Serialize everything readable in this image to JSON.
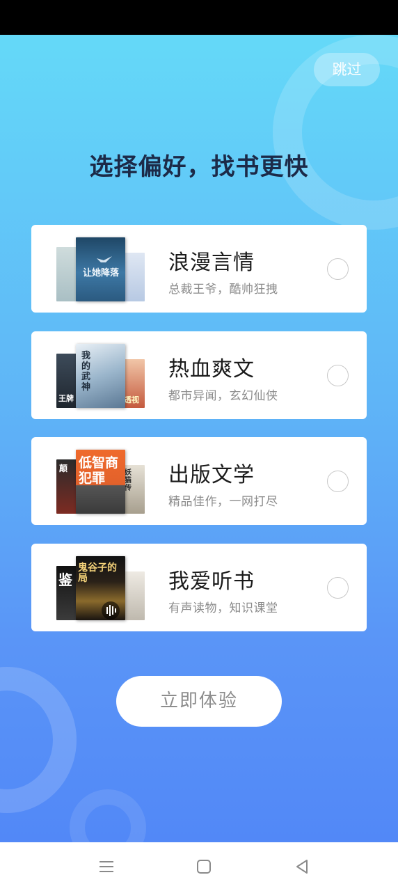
{
  "header": {
    "skip_label": "跳过"
  },
  "page": {
    "title": "选择偏好，找书更快"
  },
  "preferences": [
    {
      "title": "浪漫言情",
      "subtitle": "总裁王爷，酷帅狂拽",
      "selected": false,
      "cover_text": "让她降落",
      "colors": {
        "left": "#b9ccd0",
        "mid": "#2e5f86",
        "right": "#c6d6ea"
      }
    },
    {
      "title": "热血爽文",
      "subtitle": "都市异闻，玄幻仙侠",
      "selected": false,
      "cover_text": "我的武神",
      "left_cover_text": "王牌",
      "right_cover_text": "透视",
      "colors": {
        "left": "#2b3440",
        "mid": "#9bb6cc",
        "right": "#d88a6a"
      }
    },
    {
      "title": "出版文学",
      "subtitle": "精品佳作，一网打尽",
      "selected": false,
      "cover_text": "低智商犯罪",
      "left_cover_text": "颠",
      "right_cover_text": "妖猫传",
      "colors": {
        "left": "#b03a2a",
        "mid": "#e2612b",
        "right": "#c6bfb0"
      }
    },
    {
      "title": "我爱听书",
      "subtitle": "有声读物，知识课堂",
      "selected": false,
      "cover_text": "鬼谷子的局",
      "left_cover_text": "鉴",
      "colors": {
        "left": "#1d1d1d",
        "mid": "#1a1410",
        "right": "#d8d4cc"
      }
    }
  ],
  "cta": {
    "label": "立即体验"
  },
  "nav": {
    "menu_icon": "menu-icon",
    "home_icon": "home-icon",
    "back_icon": "back-icon"
  }
}
